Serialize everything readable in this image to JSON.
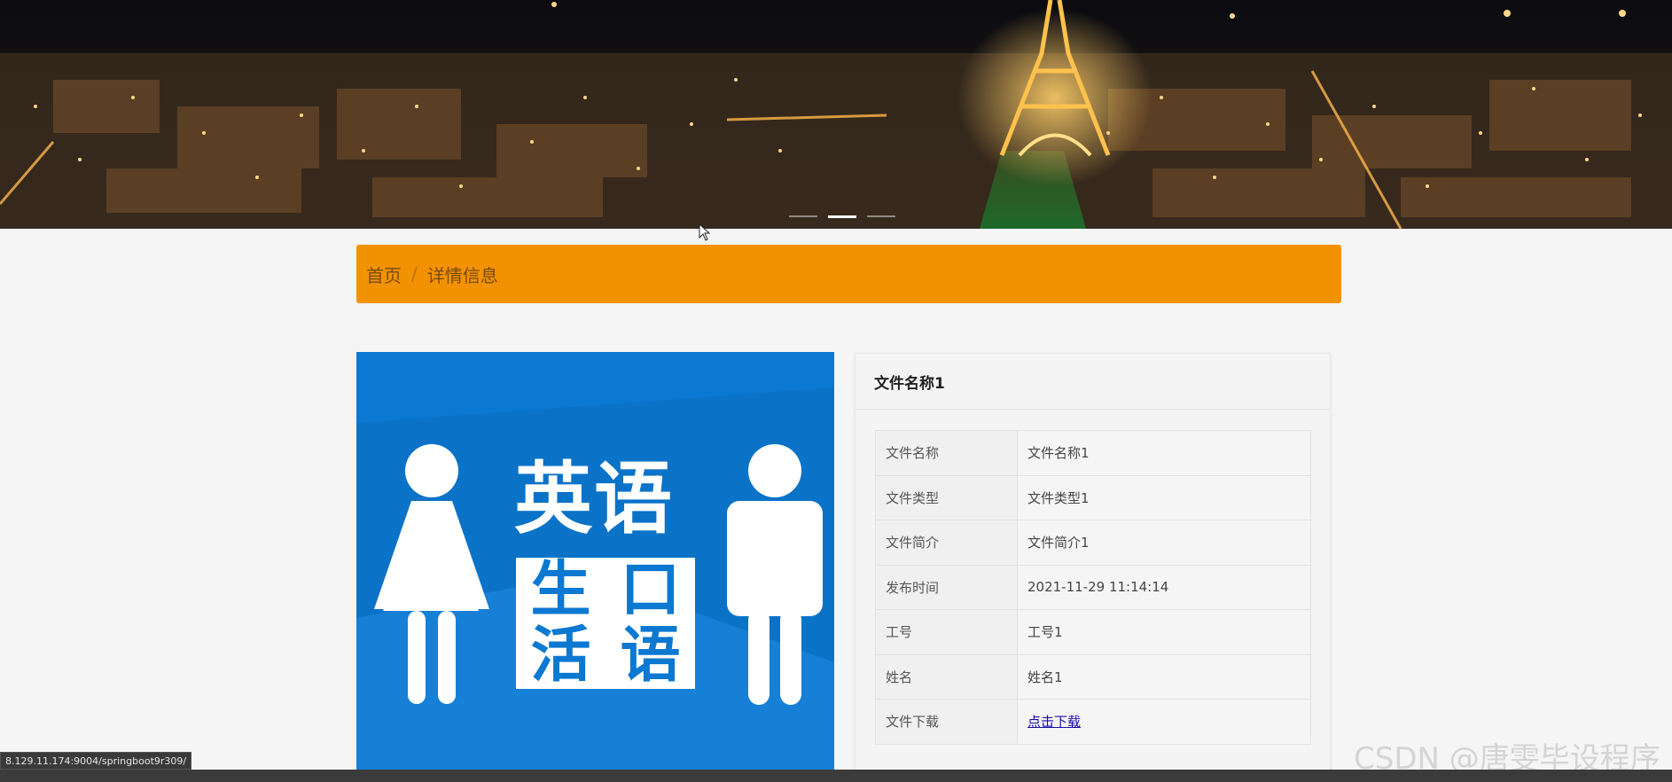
{
  "banner": {
    "alt": "Paris night skyline with Eiffel Tower",
    "slides": 3,
    "active_slide": 2
  },
  "breadcrumb": {
    "home": "首页",
    "separator": "/",
    "current": "详情信息"
  },
  "product_image": {
    "title_line": "英语",
    "box_chars": [
      "生",
      "口",
      "活",
      "语"
    ]
  },
  "detail": {
    "title": "文件名称1",
    "rows": [
      {
        "key": "文件名称",
        "value": "文件名称1"
      },
      {
        "key": "文件类型",
        "value": "文件类型1"
      },
      {
        "key": "文件简介",
        "value": "文件简介1"
      },
      {
        "key": "发布时间",
        "value": "2021-11-29 11:14:14"
      },
      {
        "key": "工号",
        "value": "工号1"
      },
      {
        "key": "姓名",
        "value": "姓名1"
      },
      {
        "key": "文件下载",
        "value": "点击下载"
      }
    ]
  },
  "status_bar": {
    "url": "8.129.11.174:9004/springboot9r309/"
  },
  "watermark": "CSDN @唐雯毕设程序",
  "colors": {
    "breadcrumb_bg": "#f39200",
    "image_bg": "#0b78d2",
    "link": "#1a0dab"
  }
}
